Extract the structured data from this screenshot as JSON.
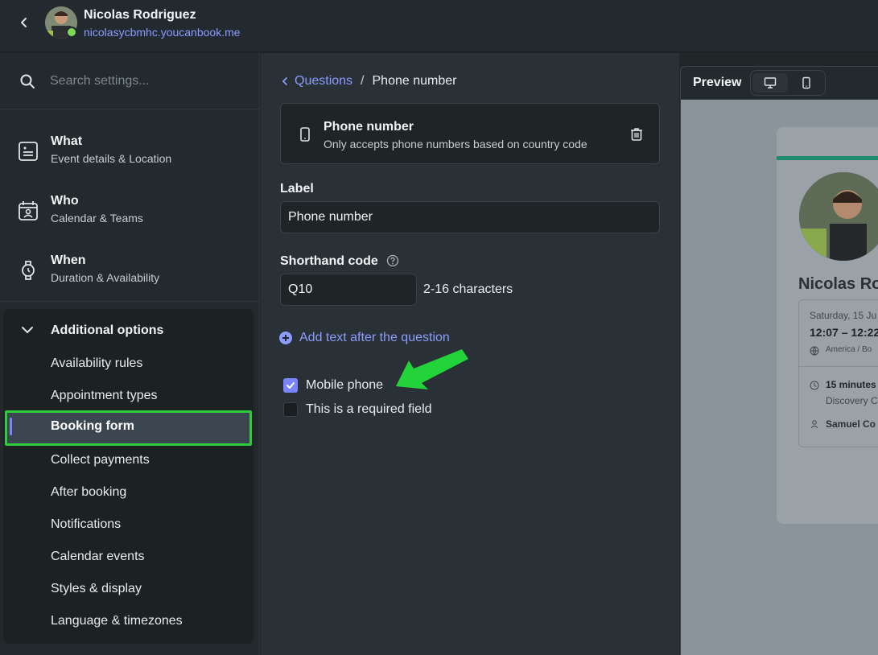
{
  "header": {
    "user_name": "Nicolas Rodriguez",
    "user_url": "nicolasycbmhc.youcanbook.me"
  },
  "sidebar": {
    "search_placeholder": "Search settings...",
    "items": [
      {
        "title": "What",
        "subtitle": "Event details & Location",
        "icon": "document-icon"
      },
      {
        "title": "Who",
        "subtitle": "Calendar & Teams",
        "icon": "calendar-person-icon"
      },
      {
        "title": "When",
        "subtitle": "Duration & Availability",
        "icon": "watch-icon"
      }
    ],
    "additional": {
      "title": "Additional options",
      "items": [
        "Availability rules",
        "Appointment types",
        "Booking form",
        "Collect payments",
        "After booking",
        "Notifications",
        "Calendar events",
        "Styles & display",
        "Language & timezones"
      ],
      "active": "Booking form"
    }
  },
  "main": {
    "breadcrumb": {
      "parent": "Questions",
      "current": "Phone number"
    },
    "question_card": {
      "title": "Phone number",
      "description": "Only accepts phone numbers based on country code"
    },
    "label_field": {
      "label": "Label",
      "value": "Phone number"
    },
    "shorthand_field": {
      "label": "Shorthand code",
      "value": "Q10",
      "hint": "2-16 characters"
    },
    "add_text_label": "Add text after the question",
    "checkboxes": [
      {
        "label": "Mobile phone",
        "checked": true
      },
      {
        "label": "This is a required field",
        "checked": false
      }
    ]
  },
  "preview": {
    "title": "Preview",
    "card": {
      "name": "Nicolas Ro",
      "date": "Saturday, 15 Ju",
      "time": "12:07 – 12:22",
      "timezone": "America / Bo",
      "duration": "15 minutes",
      "type": "Discovery C",
      "host": "Samuel Co"
    }
  },
  "colors": {
    "accent": "#8c9bff",
    "highlight_border": "#2ecc3a",
    "annotation_arrow": "#22d33a"
  }
}
